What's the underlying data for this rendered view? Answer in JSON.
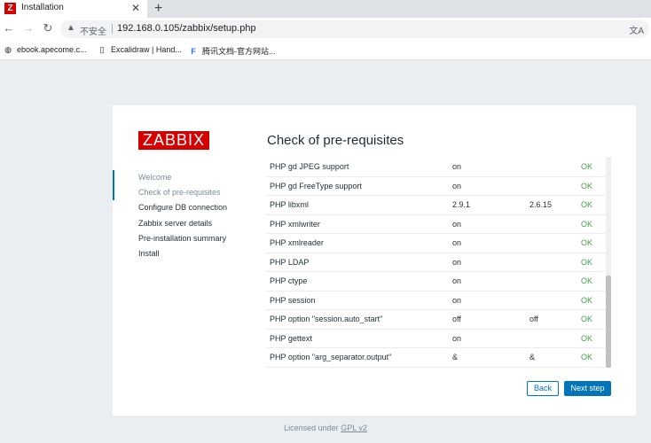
{
  "browser": {
    "tab_title": "Installation",
    "tab_favicon": "Z",
    "new_tab": "+",
    "close": "✕",
    "insecure_label": "不安全",
    "separator": "|",
    "url": "192.168.0.105/zabbix/setup.php",
    "bookmarks": [
      {
        "label": "ebook.apecome.c...",
        "icon": "globe-icon"
      },
      {
        "label": "Excalidraw | Hand...",
        "icon": "excalidraw-icon"
      },
      {
        "label": "腾讯文档-官方网站...",
        "icon": "tencent-docs-icon"
      }
    ]
  },
  "logo_text": "ZABBIX",
  "page_title": "Check of pre-requisites",
  "steps": [
    {
      "label": "Welcome"
    },
    {
      "label": "Check of pre-requisites"
    },
    {
      "label": "Configure DB connection"
    },
    {
      "label": "Zabbix server details"
    },
    {
      "label": "Pre-installation summary"
    },
    {
      "label": "Install"
    }
  ],
  "requirements": [
    {
      "name": "PHP gd JPEG support",
      "current": "on",
      "required": "",
      "status": "OK"
    },
    {
      "name": "PHP gd FreeType support",
      "current": "on",
      "required": "",
      "status": "OK"
    },
    {
      "name": "PHP libxml",
      "current": "2.9.1",
      "required": "2.6.15",
      "status": "OK"
    },
    {
      "name": "PHP xmlwriter",
      "current": "on",
      "required": "",
      "status": "OK"
    },
    {
      "name": "PHP xmlreader",
      "current": "on",
      "required": "",
      "status": "OK"
    },
    {
      "name": "PHP LDAP",
      "current": "on",
      "required": "",
      "status": "OK"
    },
    {
      "name": "PHP ctype",
      "current": "on",
      "required": "",
      "status": "OK"
    },
    {
      "name": "PHP session",
      "current": "on",
      "required": "",
      "status": "OK"
    },
    {
      "name": "PHP option \"session.auto_start\"",
      "current": "off",
      "required": "off",
      "status": "OK"
    },
    {
      "name": "PHP gettext",
      "current": "on",
      "required": "",
      "status": "OK"
    },
    {
      "name": "PHP option \"arg_separator.output\"",
      "current": "&",
      "required": "&",
      "status": "OK"
    }
  ],
  "buttons": {
    "back": "Back",
    "next": "Next step"
  },
  "footer": {
    "prefix": "Licensed under",
    "link": "GPL v2"
  },
  "colors": {
    "brand": "#d40000",
    "accent": "#0275b8",
    "ok": "#429e47"
  }
}
